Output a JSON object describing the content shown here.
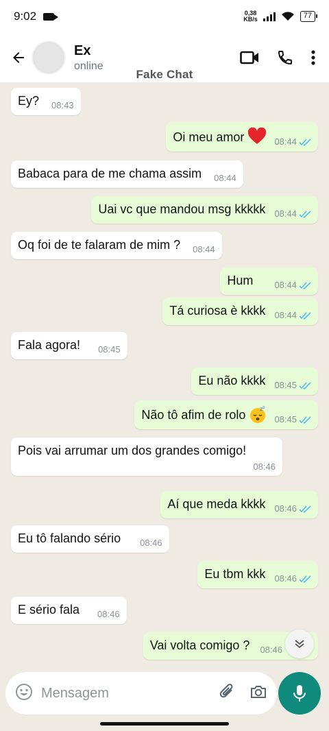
{
  "status_bar": {
    "time": "9:02",
    "net_speed_value": "0,38",
    "net_speed_unit": "KB/s",
    "battery": "77"
  },
  "header": {
    "contact_name": "Ex",
    "status": "online"
  },
  "watermark": "Fake Chat",
  "messages": [
    {
      "dir": "in",
      "text": "Ey?",
      "time": "08:43"
    },
    {
      "dir": "out",
      "text": "Oi meu amor",
      "time": "08:44",
      "emoji": "red-heart"
    },
    {
      "dir": "in",
      "text": "Babaca para de me chama assim",
      "time": "08:44"
    },
    {
      "dir": "out",
      "text": "Uai vc que mandou msg kkkkk",
      "time": "08:44"
    },
    {
      "dir": "in",
      "text": "Oq foi de te falaram de mim ?",
      "time": "08:44"
    },
    {
      "dir": "out",
      "text": "Hum",
      "time": "08:44"
    },
    {
      "dir": "out",
      "text": "Tá curiosa è kkkk",
      "time": "08:44"
    },
    {
      "dir": "in",
      "text": "Fala agora!",
      "time": "08:45"
    },
    {
      "dir": "out",
      "text": "Eu não kkkk",
      "time": "08:45"
    },
    {
      "dir": "out",
      "text": "Não tô afim de rolo",
      "time": "08:45",
      "emoji": "sleeping-face"
    },
    {
      "dir": "in",
      "text": "Pois vai arrumar um dos grandes comigo!",
      "time": "08:46"
    },
    {
      "dir": "out",
      "text": "Aí que meda kkkk",
      "time": "08:46"
    },
    {
      "dir": "in",
      "text": "Eu tô falando sério",
      "time": "08:46"
    },
    {
      "dir": "out",
      "text": "Eu tbm kkk",
      "time": "08:46"
    },
    {
      "dir": "in",
      "text": "E sério fala",
      "time": "08:46"
    },
    {
      "dir": "out",
      "text": "Vai volta comigo ?",
      "time": "08:46"
    }
  ],
  "input": {
    "placeholder": "Mensagem"
  },
  "icons": {
    "back": "arrow-left-icon",
    "video": "video-call-icon",
    "call": "phone-icon",
    "menu": "more-vert-icon",
    "emoji": "emoji-icon",
    "attach": "paperclip-icon",
    "camera": "camera-icon",
    "mic": "mic-icon",
    "scroll": "double-chevron-down-icon",
    "read": "double-check-icon"
  },
  "colors": {
    "accent": "#0f8a7c",
    "read_tick": "#53bdeb",
    "outgoing_bubble": "#e7fcd6",
    "incoming_bubble": "#ffffff",
    "chat_bg": "#efeae2"
  }
}
